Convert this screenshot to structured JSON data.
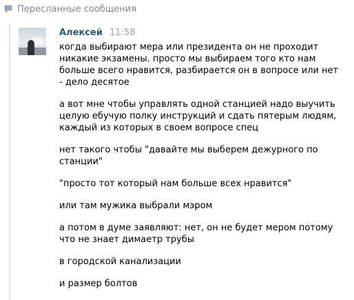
{
  "header": {
    "title": "Пересланные сообщения",
    "icon": "speech-bubble-icon"
  },
  "message": {
    "author": "Алексей",
    "time": "11:58",
    "avatar": "user-avatar",
    "paragraphs": [
      "когда выбирают мера или президента он не проходит никакие экзамены. просто мы выбираем того кто нам больше всего нравится, разбирается он в вопросе или нет - дело десятое",
      "а вот мне чтобы управлять одной станцией надо выучить целую ебучую полку инструкций и сдать пятерым людям, каждый из которых в своем вопросе спец",
      "нет такого чтобы \"давайте мы выберем дежурного по станции\"",
      "\"просто тот который нам больше всех нравится\"",
      "или там мужика выбрали мэром",
      "а потом в думе заявляют: нет, он не будет мером потому что не знает димаетр трубы",
      "в городской канализации",
      "и размер болтов"
    ]
  },
  "colors": {
    "link": "#2b587a",
    "muted": "#7b8998",
    "rule": "#dfe5ec"
  }
}
